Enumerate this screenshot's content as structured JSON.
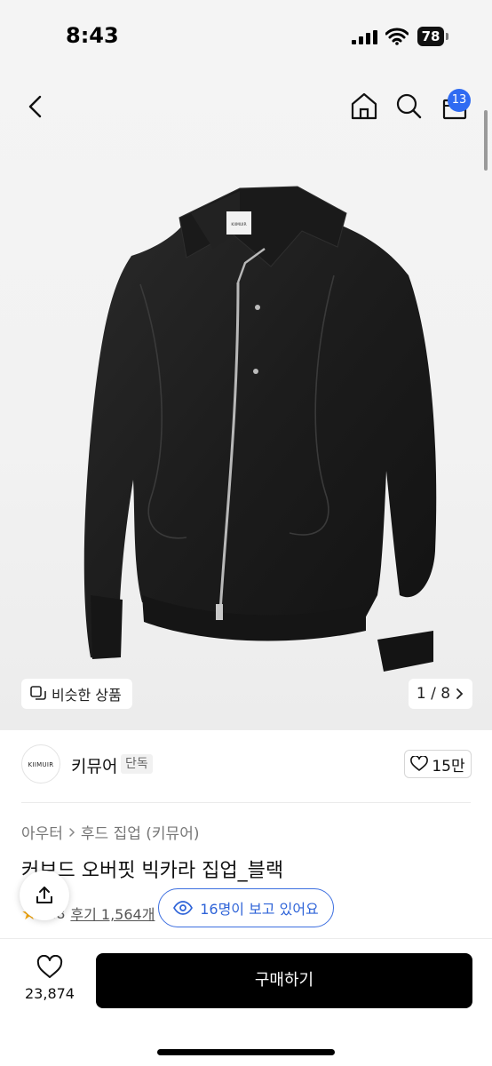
{
  "status_bar": {
    "time": "8:43",
    "battery": "78"
  },
  "nav": {
    "cart_count": "13"
  },
  "hero": {
    "similar_label": "비슷한 상품",
    "page_indicator": "1 / 8",
    "label_brand": "KIIMUIR"
  },
  "brand": {
    "logo_text": "KIIMUIR",
    "name": "키뮤어",
    "tag": "단독",
    "likes": "15만"
  },
  "breadcrumb": {
    "category": "아우터",
    "sub_category": "후드 집업 (키뮤어)"
  },
  "product": {
    "title": "커브드 오버핏 빅카라 집업_블랙",
    "rating": "4.8",
    "reviews": "후기 1,564개"
  },
  "viewers": "16명이 보고 있어요",
  "bottom": {
    "wish_count": "23,874",
    "buy_label": "구매하기"
  },
  "colors": {
    "accent": "#2f6bf2",
    "buy_button": "#000000",
    "star": "#f6a70b"
  }
}
